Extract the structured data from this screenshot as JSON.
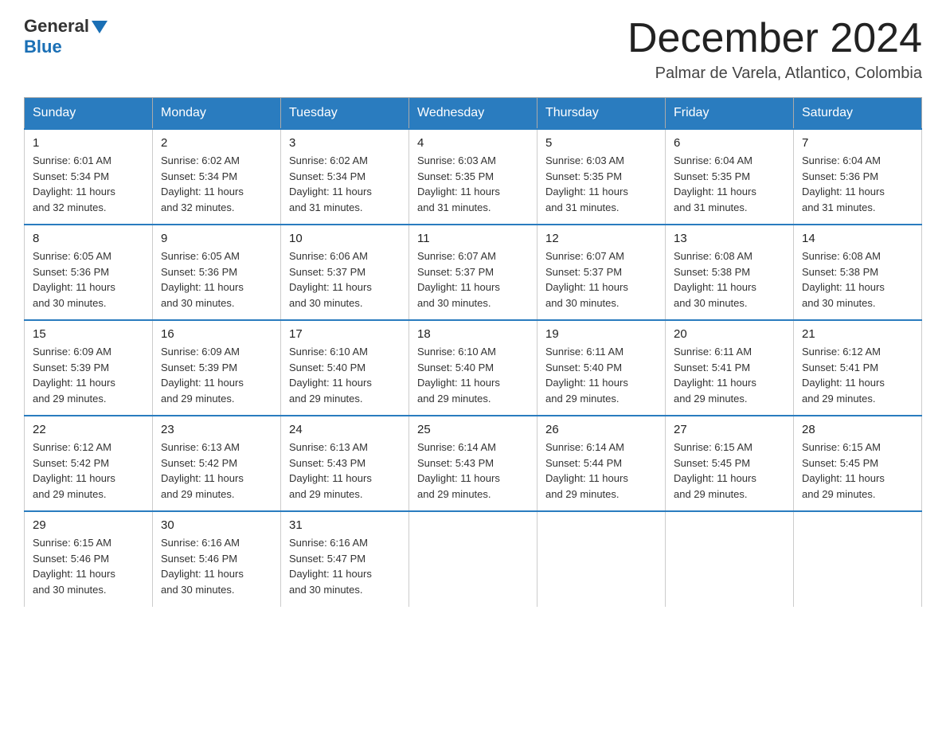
{
  "logo": {
    "general": "General",
    "blue": "Blue"
  },
  "header": {
    "month": "December 2024",
    "location": "Palmar de Varela, Atlantico, Colombia"
  },
  "days_of_week": [
    "Sunday",
    "Monday",
    "Tuesday",
    "Wednesday",
    "Thursday",
    "Friday",
    "Saturday"
  ],
  "weeks": [
    [
      {
        "day": "1",
        "info": "Sunrise: 6:01 AM\nSunset: 5:34 PM\nDaylight: 11 hours\nand 32 minutes."
      },
      {
        "day": "2",
        "info": "Sunrise: 6:02 AM\nSunset: 5:34 PM\nDaylight: 11 hours\nand 32 minutes."
      },
      {
        "day": "3",
        "info": "Sunrise: 6:02 AM\nSunset: 5:34 PM\nDaylight: 11 hours\nand 31 minutes."
      },
      {
        "day": "4",
        "info": "Sunrise: 6:03 AM\nSunset: 5:35 PM\nDaylight: 11 hours\nand 31 minutes."
      },
      {
        "day": "5",
        "info": "Sunrise: 6:03 AM\nSunset: 5:35 PM\nDaylight: 11 hours\nand 31 minutes."
      },
      {
        "day": "6",
        "info": "Sunrise: 6:04 AM\nSunset: 5:35 PM\nDaylight: 11 hours\nand 31 minutes."
      },
      {
        "day": "7",
        "info": "Sunrise: 6:04 AM\nSunset: 5:36 PM\nDaylight: 11 hours\nand 31 minutes."
      }
    ],
    [
      {
        "day": "8",
        "info": "Sunrise: 6:05 AM\nSunset: 5:36 PM\nDaylight: 11 hours\nand 30 minutes."
      },
      {
        "day": "9",
        "info": "Sunrise: 6:05 AM\nSunset: 5:36 PM\nDaylight: 11 hours\nand 30 minutes."
      },
      {
        "day": "10",
        "info": "Sunrise: 6:06 AM\nSunset: 5:37 PM\nDaylight: 11 hours\nand 30 minutes."
      },
      {
        "day": "11",
        "info": "Sunrise: 6:07 AM\nSunset: 5:37 PM\nDaylight: 11 hours\nand 30 minutes."
      },
      {
        "day": "12",
        "info": "Sunrise: 6:07 AM\nSunset: 5:37 PM\nDaylight: 11 hours\nand 30 minutes."
      },
      {
        "day": "13",
        "info": "Sunrise: 6:08 AM\nSunset: 5:38 PM\nDaylight: 11 hours\nand 30 minutes."
      },
      {
        "day": "14",
        "info": "Sunrise: 6:08 AM\nSunset: 5:38 PM\nDaylight: 11 hours\nand 30 minutes."
      }
    ],
    [
      {
        "day": "15",
        "info": "Sunrise: 6:09 AM\nSunset: 5:39 PM\nDaylight: 11 hours\nand 29 minutes."
      },
      {
        "day": "16",
        "info": "Sunrise: 6:09 AM\nSunset: 5:39 PM\nDaylight: 11 hours\nand 29 minutes."
      },
      {
        "day": "17",
        "info": "Sunrise: 6:10 AM\nSunset: 5:40 PM\nDaylight: 11 hours\nand 29 minutes."
      },
      {
        "day": "18",
        "info": "Sunrise: 6:10 AM\nSunset: 5:40 PM\nDaylight: 11 hours\nand 29 minutes."
      },
      {
        "day": "19",
        "info": "Sunrise: 6:11 AM\nSunset: 5:40 PM\nDaylight: 11 hours\nand 29 minutes."
      },
      {
        "day": "20",
        "info": "Sunrise: 6:11 AM\nSunset: 5:41 PM\nDaylight: 11 hours\nand 29 minutes."
      },
      {
        "day": "21",
        "info": "Sunrise: 6:12 AM\nSunset: 5:41 PM\nDaylight: 11 hours\nand 29 minutes."
      }
    ],
    [
      {
        "day": "22",
        "info": "Sunrise: 6:12 AM\nSunset: 5:42 PM\nDaylight: 11 hours\nand 29 minutes."
      },
      {
        "day": "23",
        "info": "Sunrise: 6:13 AM\nSunset: 5:42 PM\nDaylight: 11 hours\nand 29 minutes."
      },
      {
        "day": "24",
        "info": "Sunrise: 6:13 AM\nSunset: 5:43 PM\nDaylight: 11 hours\nand 29 minutes."
      },
      {
        "day": "25",
        "info": "Sunrise: 6:14 AM\nSunset: 5:43 PM\nDaylight: 11 hours\nand 29 minutes."
      },
      {
        "day": "26",
        "info": "Sunrise: 6:14 AM\nSunset: 5:44 PM\nDaylight: 11 hours\nand 29 minutes."
      },
      {
        "day": "27",
        "info": "Sunrise: 6:15 AM\nSunset: 5:45 PM\nDaylight: 11 hours\nand 29 minutes."
      },
      {
        "day": "28",
        "info": "Sunrise: 6:15 AM\nSunset: 5:45 PM\nDaylight: 11 hours\nand 29 minutes."
      }
    ],
    [
      {
        "day": "29",
        "info": "Sunrise: 6:15 AM\nSunset: 5:46 PM\nDaylight: 11 hours\nand 30 minutes."
      },
      {
        "day": "30",
        "info": "Sunrise: 6:16 AM\nSunset: 5:46 PM\nDaylight: 11 hours\nand 30 minutes."
      },
      {
        "day": "31",
        "info": "Sunrise: 6:16 AM\nSunset: 5:47 PM\nDaylight: 11 hours\nand 30 minutes."
      },
      {
        "day": "",
        "info": ""
      },
      {
        "day": "",
        "info": ""
      },
      {
        "day": "",
        "info": ""
      },
      {
        "day": "",
        "info": ""
      }
    ]
  ]
}
